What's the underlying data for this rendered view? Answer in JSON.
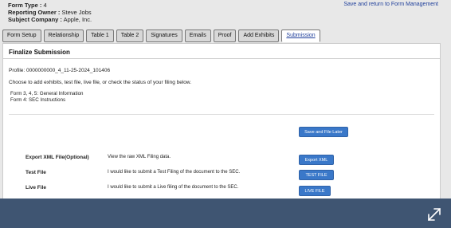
{
  "header": {
    "form_type_label": "Form Type :",
    "form_type_value": "4",
    "owner_label": "Reporting Owner :",
    "owner_value": "Steve Jobs",
    "company_label": "Subject Company :",
    "company_value": "Apple, Inc."
  },
  "return_link": "Save and return to Form Management",
  "tabs": [
    {
      "label": "Form Setup"
    },
    {
      "label": "Relationship"
    },
    {
      "label": "Table 1"
    },
    {
      "label": "Table 2"
    },
    {
      "label": "Signatures"
    },
    {
      "label": "Emails"
    },
    {
      "label": "Proof"
    },
    {
      "label": "Add Exhibits"
    },
    {
      "label": "Submission",
      "active": true
    }
  ],
  "panel": {
    "title": "Finalize Submission",
    "profile": "Profile: 0000000000_4_11-25-2024_101406",
    "instruction": "Choose to add exhibits, test file, live file, or check the status of your filing below.",
    "form_line_1": "Form 3, 4, 5: General Information",
    "form_line_2": "Form 4: SEC Instructions",
    "save_later_button": "Save and File Later",
    "rows": [
      {
        "label": "Export XML File(Optional)",
        "desc": "View the raw XML Filing data.",
        "button": "Export XML"
      },
      {
        "label": "Test File",
        "desc": "I would like to submit a Test Filing of the document to the SEC.",
        "button": "TEST FILE"
      },
      {
        "label": "Live File",
        "desc": "I would like to submit a Live filing of the document to the SEC.",
        "button": "LIVE FILE"
      }
    ]
  },
  "icons": {
    "expand": "expand-icon"
  },
  "colors": {
    "accent": "#3a78c9",
    "bottom_bar": "#3f5572",
    "link": "#1f3f9b"
  }
}
